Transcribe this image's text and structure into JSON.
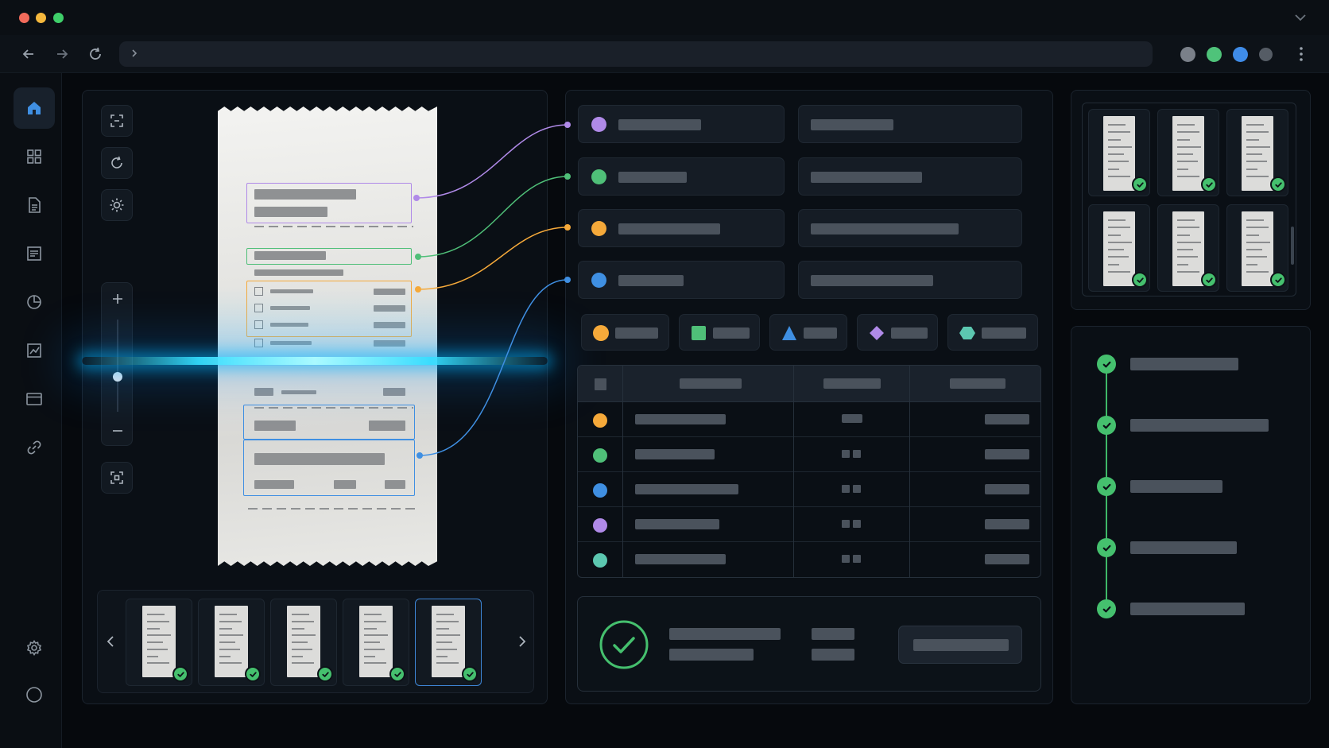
{
  "colors": {
    "purple": "#b08ae8",
    "green": "#4fbf78",
    "orange": "#f5a93a",
    "blue": "#3f8fe2",
    "teal": "#5cc7b0",
    "success": "#45c06e",
    "scan": "#32d2ff"
  },
  "icons": {
    "sidebar": [
      "home-icon",
      "grid-icon",
      "document-icon",
      "list-document-icon",
      "pie-chart-icon",
      "line-chart-icon",
      "card-icon",
      "link-icon",
      "settings-icon",
      "circle-icon"
    ],
    "tools": [
      "scan-frame-icon",
      "rotate-icon",
      "brightness-icon",
      "zoom-in-icon",
      "zoom-out-icon",
      "fit-screen-icon"
    ],
    "legend_shapes": [
      "circle",
      "square",
      "triangle",
      "diamond",
      "hexagon"
    ]
  },
  "thumbnails": [
    {
      "verified": true,
      "selected": false
    },
    {
      "verified": true,
      "selected": false
    },
    {
      "verified": true,
      "selected": false
    },
    {
      "verified": true,
      "selected": false
    },
    {
      "verified": true,
      "selected": true
    }
  ],
  "gallery": [
    {
      "verified": true
    },
    {
      "verified": true
    },
    {
      "verified": true
    },
    {
      "verified": true
    },
    {
      "verified": true
    },
    {
      "verified": true
    }
  ],
  "timeline_steps": [
    {
      "status": "done"
    },
    {
      "status": "done"
    },
    {
      "status": "done"
    },
    {
      "status": "done"
    },
    {
      "status": "done"
    }
  ]
}
